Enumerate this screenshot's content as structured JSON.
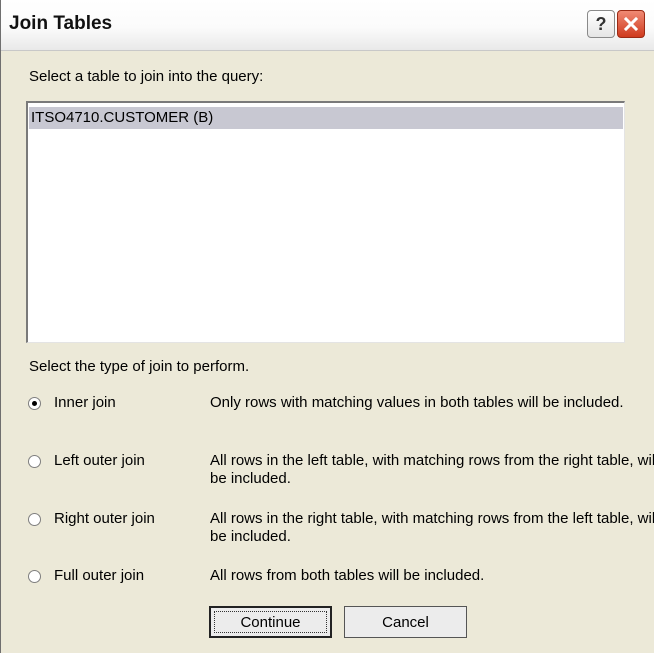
{
  "window": {
    "title": "Join Tables"
  },
  "titlebar": {
    "help_glyph": "?",
    "close_icon": "close-icon"
  },
  "table_prompt": "Select a table to join into the query:",
  "table_list": {
    "items": [
      "ITSO4710.CUSTOMER (B)"
    ],
    "selected_index": 0
  },
  "join_prompt": "Select the type of join to perform.",
  "join_types": [
    {
      "label": "Inner join",
      "description": "Only rows with matching values in both tables will be included.",
      "selected": true
    },
    {
      "label": "Left outer join",
      "description": "All rows in the left table, with matching rows from the right table, will be included.",
      "selected": false
    },
    {
      "label": "Right outer join",
      "description": "All rows in the right table, with matching rows from the left table, will be included.",
      "selected": false
    },
    {
      "label": "Full outer join",
      "description": "All rows from both tables will be included.",
      "selected": false
    }
  ],
  "buttons": {
    "continue_label": "Continue",
    "cancel_label": "Cancel"
  },
  "colors": {
    "list_selection": "#c8c8d2",
    "close_button": "#cf3a1e",
    "dialog_bg": "#ece9d8"
  }
}
